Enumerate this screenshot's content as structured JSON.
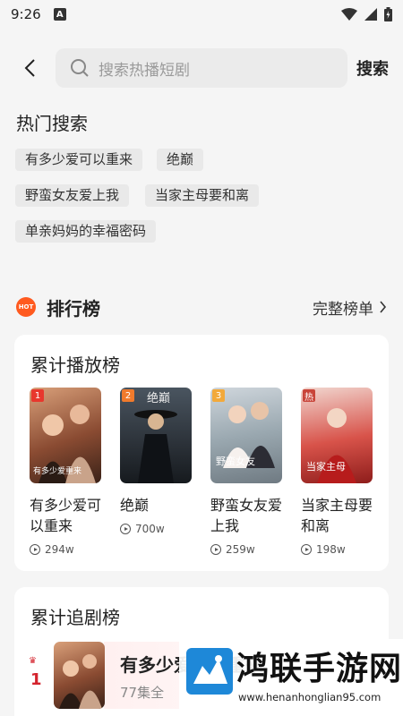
{
  "status_bar": {
    "time": "9:26",
    "notification_letter": "A"
  },
  "search": {
    "placeholder": "搜索热播短剧",
    "button_label": "搜索"
  },
  "hot_search": {
    "title": "热门搜索",
    "tags": [
      "有多少爱可以重来",
      "绝巅",
      "野蛮女友爱上我",
      "当家主母要和离",
      "单亲妈妈的幸福密码"
    ]
  },
  "ranking": {
    "badge": "HOT",
    "title": "排行榜",
    "full_list_label": "完整榜单",
    "play_chart": {
      "title": "累计播放榜",
      "items": [
        {
          "rank": "1",
          "name": "有多少爱可以重来",
          "plays": "294w",
          "rank_color": "#e8372d"
        },
        {
          "rank": "2",
          "name": "绝巅",
          "plays": "700w",
          "rank_color": "#f07a2c"
        },
        {
          "rank": "3",
          "name": "野蛮女友爱上我",
          "plays": "259w",
          "rank_color": "#f2a93b"
        },
        {
          "rank": "热",
          "name": "当家主母要和离",
          "plays": "198w",
          "rank_color": "#c9453a"
        }
      ]
    },
    "follow_chart": {
      "title": "累计追剧榜",
      "items": [
        {
          "rank": "1",
          "name": "有多少爱可以重来",
          "episodes": "77集全"
        }
      ]
    }
  },
  "watermark": {
    "text": "鸿联手游网",
    "url": "www.henanhonglian95.com"
  },
  "colors": {
    "accent_red": "#d4232d",
    "hot_orange": "#ff5a1f",
    "background": "#f5f5f5"
  }
}
